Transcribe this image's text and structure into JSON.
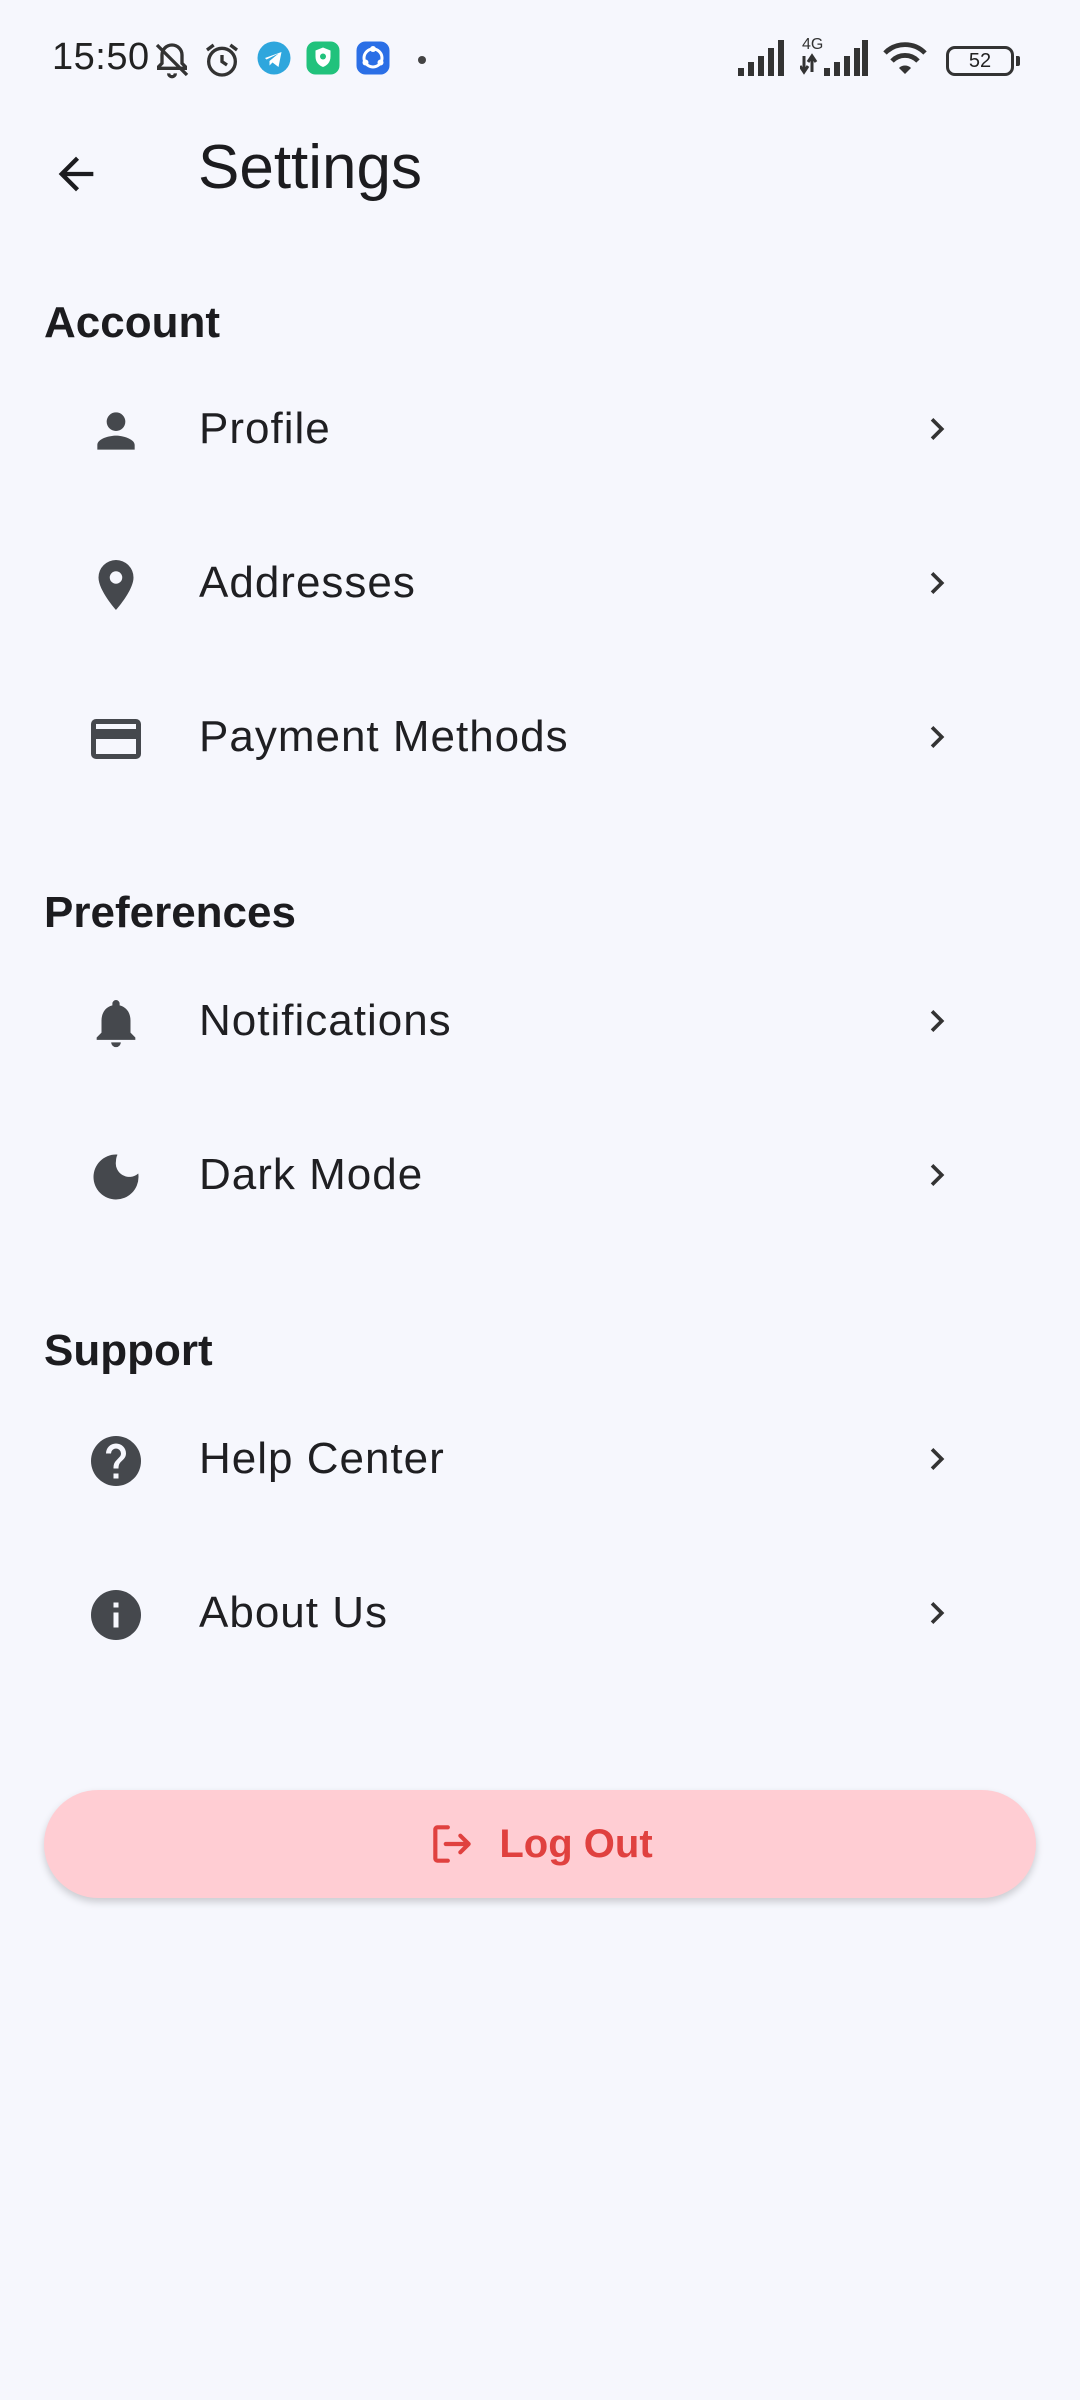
{
  "status_bar": {
    "time": "15:50",
    "network_label": "4G",
    "battery_level": "52"
  },
  "app_bar": {
    "title": "Settings"
  },
  "sections": {
    "account": {
      "title": "Account",
      "items": [
        {
          "label": "Profile",
          "icon": "person-icon"
        },
        {
          "label": "Addresses",
          "icon": "location-pin-icon"
        },
        {
          "label": "Payment Methods",
          "icon": "credit-card-icon"
        }
      ]
    },
    "preferences": {
      "title": "Preferences",
      "items": [
        {
          "label": "Notifications",
          "icon": "bell-icon"
        },
        {
          "label": "Dark Mode",
          "icon": "moon-icon"
        }
      ]
    },
    "support": {
      "title": "Support",
      "items": [
        {
          "label": "Help Center",
          "icon": "help-circle-icon"
        },
        {
          "label": "About Us",
          "icon": "info-circle-icon"
        }
      ]
    }
  },
  "logout": {
    "label": "Log Out",
    "icon": "logout-icon",
    "color": "#e0413f",
    "background": "#ffcdd3"
  },
  "colors": {
    "background": "#f6f7fd",
    "icon": "#45484d"
  }
}
